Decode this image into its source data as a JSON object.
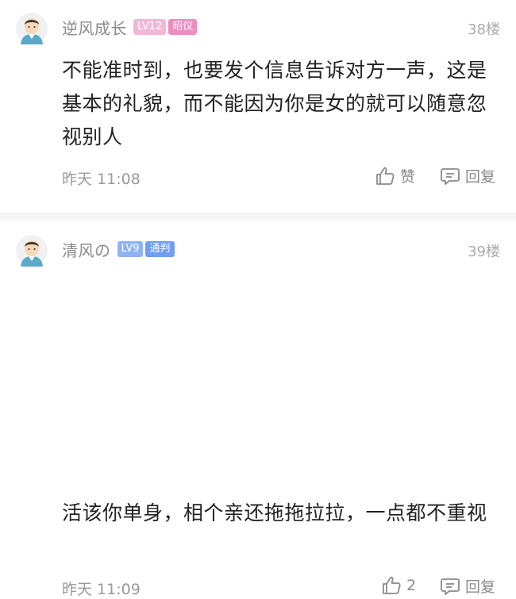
{
  "colors": {
    "lv_badge": "#8fb4f5",
    "lv12_badge": "#f3b7d6",
    "title_badge_pink": "#ec8ec1",
    "title_badge_blue": "#6f9ef2",
    "divider": "#f4f4f4"
  },
  "comments": [
    {
      "username": "逆风成长",
      "level": "LV12",
      "title": "昭仪",
      "floor": "38楼",
      "content": "不能准时到，也要发个信息告诉对方一声，这是基本的礼貌，而不能因为你是女的就可以随意忽视别人",
      "time": "昨天 11:08",
      "like_label": "赞",
      "reply_label": "回复",
      "avatar_icon": "user-avatar-icon"
    },
    {
      "username": "清风の",
      "level": "LV9",
      "title": "通判",
      "floor": "39楼",
      "content": "活该你单身，相个亲还拖拖拉拉，一点都不重视",
      "time": "昨天 11:09",
      "like_label": "2",
      "reply_label": "回复",
      "avatar_icon": "user-avatar-icon"
    }
  ]
}
